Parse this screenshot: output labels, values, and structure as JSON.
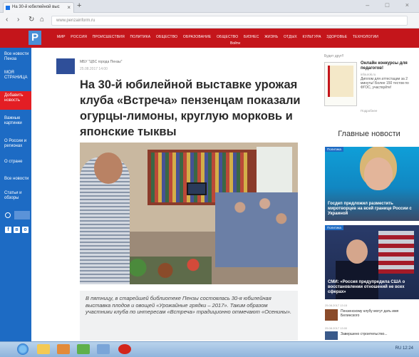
{
  "browser": {
    "tab_title": "На 30-й юбилейной выс",
    "new_tab": "+",
    "url": "www.penzainform.ru",
    "controls": "– □ ×"
  },
  "site": {
    "logo": "P",
    "nav": [
      "МИР",
      "РОССИЯ",
      "ПРОИСШЕСТВИЯ",
      "ПОЛИТИКА",
      "ОБЩЕСТВО",
      "ОБРАЗОВАНИЕ",
      "ОБЩЕСТВО",
      "БИЗНЕС",
      "ЖИЗНЬ",
      "ОТДЫХ",
      "КУЛЬТУРА",
      "ЗДОРОВЬЕ",
      "ТЕХНОЛОГИИ"
    ],
    "nav_user": "Войти"
  },
  "sidebar": {
    "items": [
      {
        "label": "Все новости Пенза"
      },
      {
        "label": "МОЯ СТРАНИЦА"
      },
      {
        "label": "Добавить новость"
      },
      {
        "label": "Важные картинки"
      },
      {
        "label": "О России и регионах"
      },
      {
        "label": "О стране"
      },
      {
        "label": "Все новости"
      },
      {
        "label": "Статьи и обзоры"
      }
    ],
    "social": [
      "f",
      "в",
      "о"
    ]
  },
  "article": {
    "source": "МБУ \"ЦБС города Пензы\"",
    "date": "25.08.2017 14:00",
    "headline": "На 30-й юбилейной выставке урожая клуба «Встреча» пензенцам показали огурцы-лимоны, круглую морковь и японские тыквы",
    "caption": "В пятницу, в старейшей библиотеке Пензы состоялась 30-я юбилейная выставка плодов и овощей «Урожайные грядки – 2017». Таким образом участники клуба по интересам «Встреча» традиционно отмечают «Осенины»."
  },
  "right": {
    "promo_label": "Будет друг!!",
    "promo_title": "Онлайн конкурсы для педагогов!",
    "promo_src": "infourok.ru",
    "promo_text": "Диплом для аттестации за 2 минуты! Более 150 тестов по ФГОС, участвуйте!",
    "promo_more": "Подробнее",
    "header": "Главные новости",
    "cards": [
      {
        "badge": "Политика",
        "title": "Госдеп предложил разместить миротворцев на всей границе России с Украиной"
      },
      {
        "badge": "Политика",
        "title": "СМИ: «Россия предупредила США о восстановлении отношений не всех сферах»"
      }
    ],
    "mini": [
      {
        "date": "25.08.2017 13:15",
        "text": "Пензенскому клубу могут дать имя Белинского"
      },
      {
        "date": "25.08.2017 13:00",
        "text": "Завершено строительство..."
      }
    ]
  },
  "taskbar": {
    "tray_text": "RU 12:24"
  }
}
